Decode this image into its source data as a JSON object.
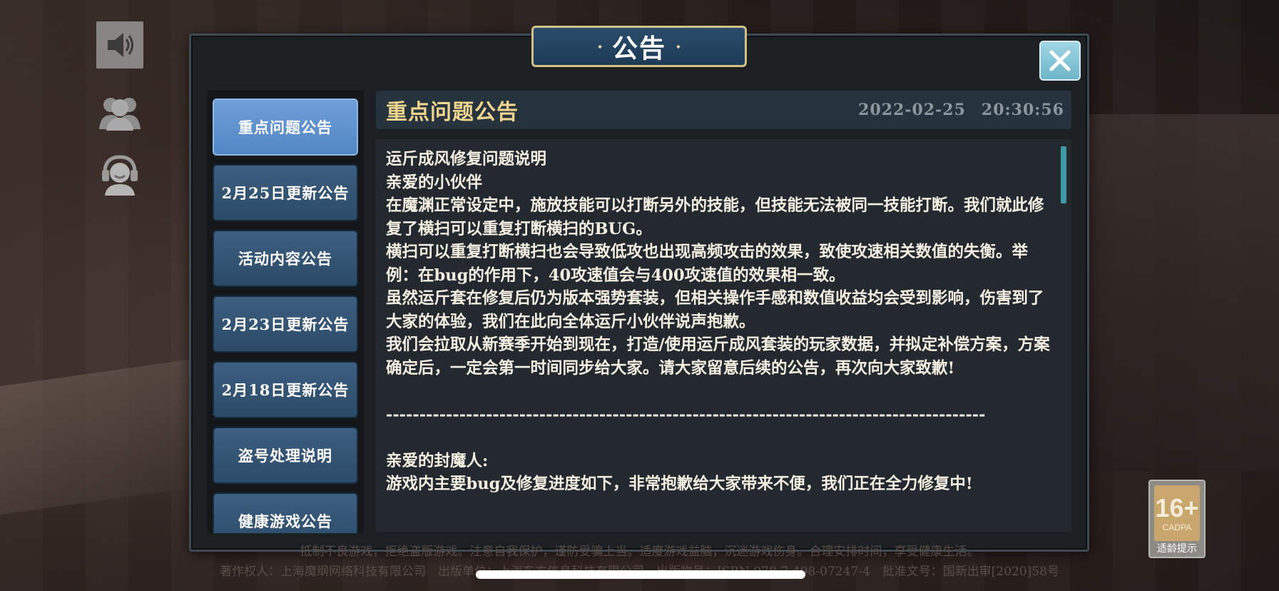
{
  "dialog": {
    "title": "公告",
    "title_deco_left": "⬩",
    "title_deco_right": "⬩"
  },
  "tabs": [
    {
      "label": "重点问题公告",
      "active": true
    },
    {
      "label": "2月25日更新公告",
      "active": false
    },
    {
      "label": "活动内容公告",
      "active": false
    },
    {
      "label": "2月23日更新公告",
      "active": false
    },
    {
      "label": "2月18日更新公告",
      "active": false
    },
    {
      "label": "盗号处理说明",
      "active": false
    },
    {
      "label": "健康游戏公告",
      "active": false
    }
  ],
  "content": {
    "title": "重点问题公告",
    "date": "2022-02-25",
    "time": "20:30:56",
    "body": "运斤成风修复问题说明\n亲爱的小伙伴\n在魔渊正常设定中，施放技能可以打断另外的技能，但技能无法被同一技能打断。我们就此修复了横扫可以重复打断横扫的BUG。\n横扫可以重复打断横扫也会导致低攻也出现高频攻击的效果，致使攻速相关数值的失衡。举例：在bug的作用下，40攻速值会与400攻速值的效果相一致。\n虽然运斤套在修复后仍为版本强势套装，但相关操作手感和数值收益均会受到影响，伤害到了大家的体验，我们在此向全体运斤小伙伴说声抱歉。\n我们会拉取从新赛季开始到现在，打造/使用运斤成风套装的玩家数据，并拟定补偿方案，方案确定后，一定会第一时间同步给大家。请大家留意后续的公告，再次向大家致歉!\n\n------------------------------------------------------------------------------------------\n\n亲爱的封魔人:\n游戏内主要bug及修复进度如下，非常抱歉给大家带来不便，我们正在全力修复中!"
  },
  "footer": {
    "line1": "抵制不良游戏，拒绝盗版游戏。注意自我保护，谨防受骗上当。适度游戏益脑，沉迷游戏伤身。合理安排时间，享受健康生活。",
    "line2": "著作权人：上海魔纲网络科技有限公司　出版单位：上海东方信息科技有限公司　出版物号：ISBN 978-7-498-07247-4　批准文号：国新出审[2020]58号"
  },
  "age_rating": {
    "number": "16+",
    "org": "CADPA",
    "label": "适龄提示"
  },
  "colors": {
    "active_tab": "#5186c3",
    "tab": "#2b4a68",
    "title_gold": "#f0d590",
    "close_button": "#6fb5c9"
  },
  "icons": {
    "sound": "speaker-icon",
    "friends": "friends-icon",
    "support": "customer-service-icon",
    "close": "close-icon"
  }
}
